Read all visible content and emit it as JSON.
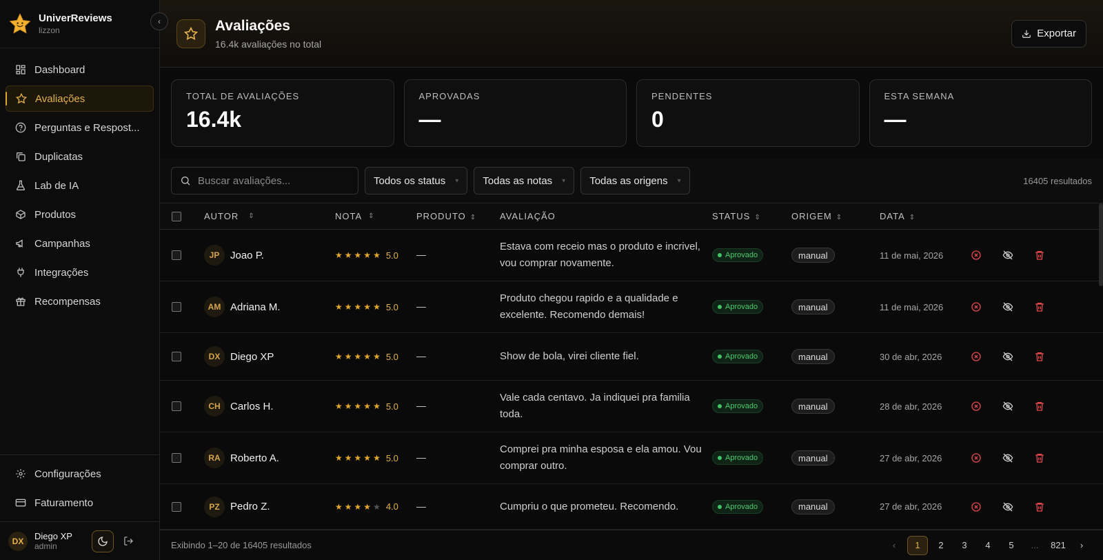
{
  "brand": {
    "name": "UniverReviews",
    "sub": "lizzon"
  },
  "nav": {
    "items": [
      {
        "label": "Dashboard",
        "icon": "dashboard-icon"
      },
      {
        "label": "Avaliações",
        "icon": "star-icon",
        "active": true
      },
      {
        "label": "Perguntas e Respost...",
        "icon": "help-circle-icon"
      },
      {
        "label": "Duplicatas",
        "icon": "copy-icon"
      },
      {
        "label": "Lab de IA",
        "icon": "flask-icon"
      },
      {
        "label": "Produtos",
        "icon": "box-icon"
      },
      {
        "label": "Campanhas",
        "icon": "megaphone-icon"
      },
      {
        "label": "Integrações",
        "icon": "plug-icon"
      },
      {
        "label": "Recompensas",
        "icon": "gift-icon"
      }
    ],
    "bottom": [
      {
        "label": "Configurações",
        "icon": "gear-icon"
      },
      {
        "label": "Faturamento",
        "icon": "credit-card-icon"
      }
    ]
  },
  "user": {
    "initials": "DX",
    "name": "Diego XP",
    "role": "admin"
  },
  "header": {
    "title": "Avaliações",
    "subtitle": "16.4k avaliações no total",
    "export_label": "Exportar"
  },
  "stats": [
    {
      "label": "TOTAL DE AVALIAÇÕES",
      "value": "16.4k"
    },
    {
      "label": "APROVADAS",
      "value": "—"
    },
    {
      "label": "PENDENTES",
      "value": "0"
    },
    {
      "label": "ESTA SEMANA",
      "value": "—"
    }
  ],
  "filters": {
    "search_placeholder": "Buscar avaliações...",
    "status": "Todos os status",
    "nota": "Todas as notas",
    "origem": "Todas as origens",
    "results": "16405 resultados"
  },
  "table": {
    "columns": {
      "autor": "AUTOR",
      "nota": "NOTA",
      "produto": "PRODUTO",
      "avaliacao": "AVALIAÇÃO",
      "status": "STATUS",
      "origem": "ORIGEM",
      "data": "DATA"
    },
    "rows": [
      {
        "initials": "JP",
        "author": "Joao P.",
        "stars": 5,
        "rating": "5.0",
        "product": "—",
        "review": "Estava com receio mas o produto e incrivel, vou comprar novamente.",
        "status": "Aprovado",
        "origin": "manual",
        "date": "11 de mai, 2026"
      },
      {
        "initials": "AM",
        "author": "Adriana M.",
        "stars": 5,
        "rating": "5.0",
        "product": "—",
        "review": "Produto chegou rapido e a qualidade e excelente. Recomendo demais!",
        "status": "Aprovado",
        "origin": "manual",
        "date": "11 de mai, 2026"
      },
      {
        "initials": "DX",
        "author": "Diego XP",
        "stars": 5,
        "rating": "5.0",
        "product": "—",
        "review": "Show de bola, virei cliente fiel.",
        "status": "Aprovado",
        "origin": "manual",
        "date": "30 de abr, 2026"
      },
      {
        "initials": "CH",
        "author": "Carlos H.",
        "stars": 5,
        "rating": "5.0",
        "product": "—",
        "review": "Vale cada centavo. Ja indiquei pra familia toda.",
        "status": "Aprovado",
        "origin": "manual",
        "date": "28 de abr, 2026"
      },
      {
        "initials": "RA",
        "author": "Roberto A.",
        "stars": 5,
        "rating": "5.0",
        "product": "—",
        "review": "Comprei pra minha esposa e ela amou. Vou comprar outro.",
        "status": "Aprovado",
        "origin": "manual",
        "date": "27 de abr, 2026"
      },
      {
        "initials": "PZ",
        "author": "Pedro Z.",
        "stars": 4,
        "rating": "4.0",
        "product": "—",
        "review": "Cumpriu o que prometeu. Recomendo.",
        "status": "Aprovado",
        "origin": "manual",
        "date": "27 de abr, 2026"
      }
    ]
  },
  "footer": {
    "text": "Exibindo 1–20 de 16405 resultados",
    "pages": [
      "1",
      "2",
      "3",
      "4",
      "5",
      "...",
      "821"
    ],
    "current_page": "1"
  },
  "colors": {
    "accent": "#e4a92c",
    "success": "#3fc466",
    "danger": "#e5484d"
  }
}
